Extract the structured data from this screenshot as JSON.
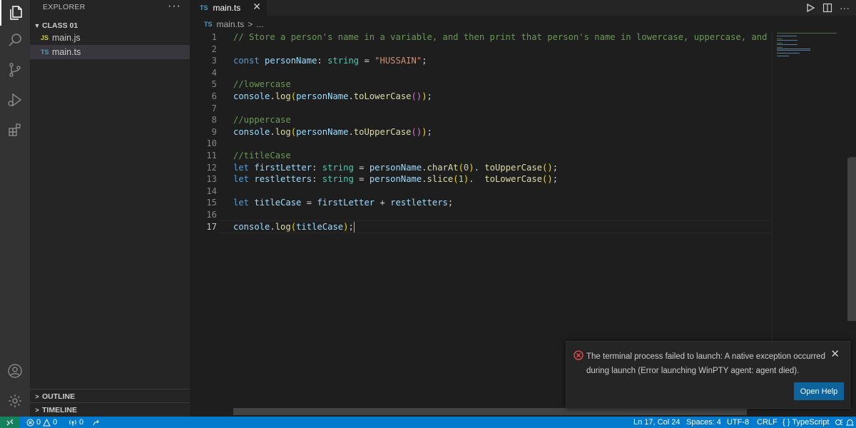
{
  "explorer": {
    "title": "EXPLORER",
    "more": "···",
    "folder": "CLASS 01",
    "files": [
      {
        "badge": "JS",
        "name": "main.js",
        "badge_color": "#cbcb41"
      },
      {
        "badge": "TS",
        "name": "main.ts",
        "badge_color": "#519aba"
      }
    ],
    "outline": "OUTLINE",
    "timeline": "TIMELINE"
  },
  "tab": {
    "badge": "TS",
    "label": "main.ts",
    "close": "✕"
  },
  "breadcrumb": {
    "badge": "TS",
    "file": "main.ts",
    "sep": ">",
    "rest": "..."
  },
  "editor": {
    "line_numbers": [
      "1",
      "2",
      "3",
      "4",
      "5",
      "6",
      "7",
      "8",
      "9",
      "10",
      "11",
      "12",
      "13",
      "14",
      "15",
      "16",
      "17"
    ],
    "current_line": 17,
    "lines": [
      "// Store a person's name in a variable, and then print that person's name in lowercase, uppercase, and titlecase",
      "",
      "const personName: string = \"HUSSAIN\";",
      "",
      "//lowercase",
      "console.log(personName.toLowerCase());",
      "",
      "//uppercase",
      "console.log(personName.toUpperCase());",
      "",
      "//titleCase",
      "let firstLetter: string = personName.charAt(0). toUpperCase();",
      "let restletters: string = personName.slice(1).  toLowerCase();",
      "",
      "let titleCase = firstLetter + restletters;",
      "",
      "console.log(titleCase);"
    ]
  },
  "notification": {
    "message": "The terminal process failed to launch: A native exception occurred during launch (Error launching WinPTY agent: agent died).",
    "button": "Open Help",
    "close": "✕"
  },
  "statusbar": {
    "errors": "0",
    "warnings": "0",
    "ports": "0",
    "position": "Ln 17, Col 24",
    "spaces": "Spaces: 4",
    "encoding": "UTF-8",
    "eol": "CRLF",
    "language": "TypeScript",
    "language_icon": "{ }"
  },
  "colors": {
    "accent": "#007acc",
    "remote": "#16825d",
    "error": "#f14c4c",
    "button": "#0e639c"
  }
}
